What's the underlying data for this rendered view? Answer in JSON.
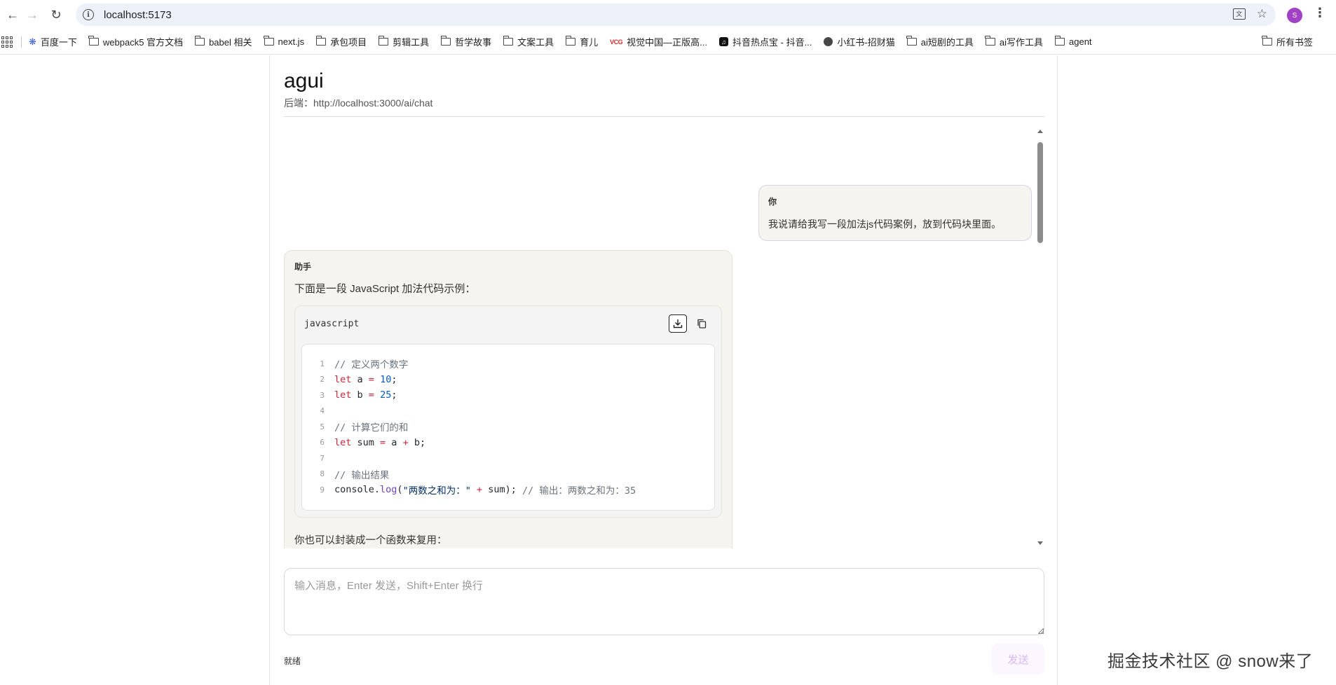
{
  "browser": {
    "url": "localhost:5173",
    "profile_initial": "S",
    "bookmarks": [
      {
        "label": "百度一下",
        "icon": "paw-icon"
      },
      {
        "label": "webpack5 官方文档",
        "icon": "folder-icon"
      },
      {
        "label": "babel 相关",
        "icon": "folder-icon"
      },
      {
        "label": "next.js",
        "icon": "folder-icon"
      },
      {
        "label": "承包项目",
        "icon": "folder-icon"
      },
      {
        "label": "剪辑工具",
        "icon": "folder-icon"
      },
      {
        "label": "哲学故事",
        "icon": "folder-icon"
      },
      {
        "label": "文案工具",
        "icon": "folder-icon"
      },
      {
        "label": "育儿",
        "icon": "folder-icon"
      },
      {
        "label": "视觉中国—正版高...",
        "icon": "vcg-icon"
      },
      {
        "label": "抖音热点宝 - 抖音...",
        "icon": "tiktok-icon"
      },
      {
        "label": "小红书-招财猫",
        "icon": "globe-icon"
      },
      {
        "label": "ai短剧的工具",
        "icon": "folder-icon"
      },
      {
        "label": "ai写作工具",
        "icon": "folder-icon"
      },
      {
        "label": "agent",
        "icon": "folder-icon"
      }
    ],
    "all_bookmarks_label": "所有书签"
  },
  "app": {
    "title": "agui",
    "backend_label": "后端：http://localhost:3000/ai/chat"
  },
  "messages": {
    "user": {
      "role": "你",
      "text": "我说请给我写一段加法js代码案例，放到代码块里面。"
    },
    "assistant": {
      "role": "助手",
      "intro": "下面是一段 JavaScript 加法代码示例：",
      "code_lang": "javascript",
      "code_lines": [
        {
          "n": "1",
          "tokens": [
            [
              "cm",
              "// 定义两个数字"
            ]
          ]
        },
        {
          "n": "2",
          "tokens": [
            [
              "kw",
              "let"
            ],
            [
              "id",
              " a "
            ],
            [
              "op",
              "="
            ],
            [
              "id",
              " "
            ],
            [
              "num",
              "10"
            ],
            [
              "id",
              ";"
            ]
          ]
        },
        {
          "n": "3",
          "tokens": [
            [
              "kw",
              "let"
            ],
            [
              "id",
              " b "
            ],
            [
              "op",
              "="
            ],
            [
              "id",
              " "
            ],
            [
              "num",
              "25"
            ],
            [
              "id",
              ";"
            ]
          ]
        },
        {
          "n": "4",
          "tokens": []
        },
        {
          "n": "5",
          "tokens": [
            [
              "cm",
              "// 计算它们的和"
            ]
          ]
        },
        {
          "n": "6",
          "tokens": [
            [
              "kw",
              "let"
            ],
            [
              "id",
              " sum "
            ],
            [
              "op",
              "="
            ],
            [
              "id",
              " a "
            ],
            [
              "op",
              "+"
            ],
            [
              "id",
              " b;"
            ]
          ]
        },
        {
          "n": "7",
          "tokens": []
        },
        {
          "n": "8",
          "tokens": [
            [
              "cm",
              "// 输出结果"
            ]
          ]
        },
        {
          "n": "9",
          "tokens": [
            [
              "id",
              "console."
            ],
            [
              "fn",
              "log"
            ],
            [
              "id",
              "("
            ],
            [
              "str",
              "\"两数之和为：\""
            ],
            [
              "id",
              " "
            ],
            [
              "op",
              "+"
            ],
            [
              "id",
              " sum); "
            ],
            [
              "cm",
              "// 输出：两数之和为：35"
            ]
          ]
        }
      ],
      "tail": "你也可以封装成一个函数来复用："
    }
  },
  "composer": {
    "placeholder": "输入消息，Enter 发送，Shift+Enter 换行",
    "value": ""
  },
  "status_text": "就绪",
  "send_label": "发送",
  "watermark": "掘金技术社区 @ snow来了"
}
